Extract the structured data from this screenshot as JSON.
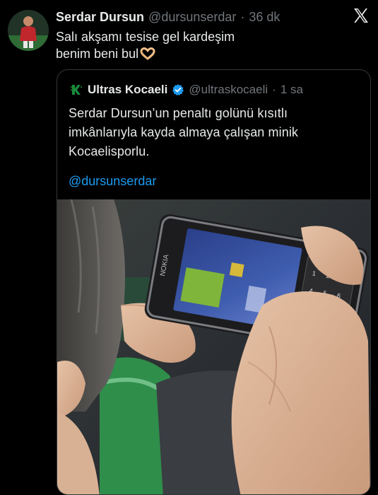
{
  "post": {
    "display_name": "Serdar Dursun",
    "handle": "@dursunserdar",
    "separator": "·",
    "time": "36 dk",
    "text_line1": "Salı akşamı tesise gel kardeşim",
    "text_line2": "benim beni bul",
    "emoji": "heart-hands-emoji"
  },
  "quote": {
    "display_name": "Ultras Kocaeli",
    "handle": "@ultraskocaeli",
    "separator": "·",
    "time": "1 sa",
    "text": "Serdar Dursun’un penaltı golünü kısıtlı imkânlarıyla kayda almaya çalışan minik Kocaelisporlu.",
    "mention": "@dursunserdar"
  },
  "icons": {
    "brand": "x-logo-icon",
    "verified": "verified-badge-icon",
    "colors": {
      "accent": "#1d9bf0",
      "muted": "#71767b",
      "text": "#e7e9ea",
      "club_green": "#1a8a3a"
    }
  },
  "media": {
    "description_icon": "phone-recording-photo"
  }
}
